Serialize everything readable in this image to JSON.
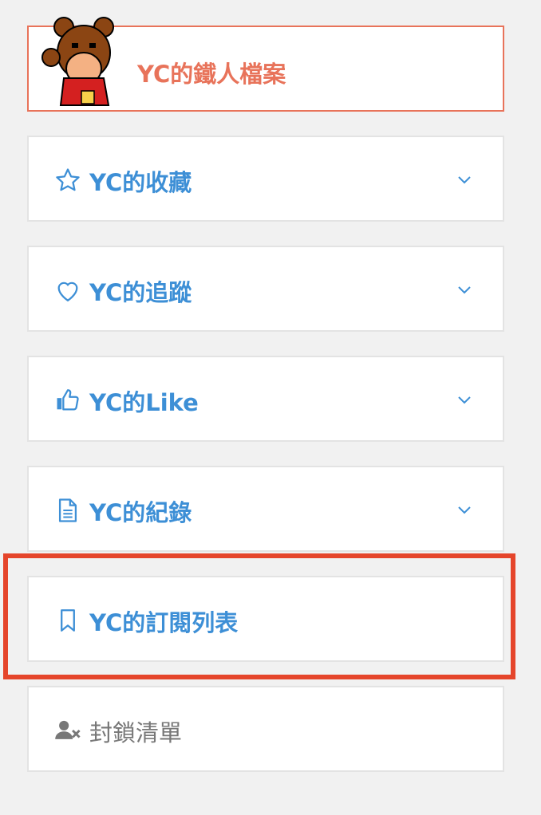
{
  "profile": {
    "title": "YC的鐵人檔案"
  },
  "menu": [
    {
      "label": "YC的收藏",
      "icon": "star-icon",
      "expandable": true
    },
    {
      "label": "YC的追蹤",
      "icon": "heart-icon",
      "expandable": true
    },
    {
      "label": "YC的Like",
      "icon": "thumbs-up-icon",
      "expandable": true
    },
    {
      "label": "YC的紀錄",
      "icon": "document-icon",
      "expandable": true
    },
    {
      "label": "YC的訂閱列表",
      "icon": "bookmark-icon",
      "expandable": false,
      "highlighted": true
    },
    {
      "label": "封鎖清單",
      "icon": "user-block-icon",
      "expandable": false
    }
  ],
  "colors": {
    "accent": "#3d8fd6",
    "profile": "#e8735a",
    "highlight": "#e5452b",
    "muted": "#777777"
  }
}
